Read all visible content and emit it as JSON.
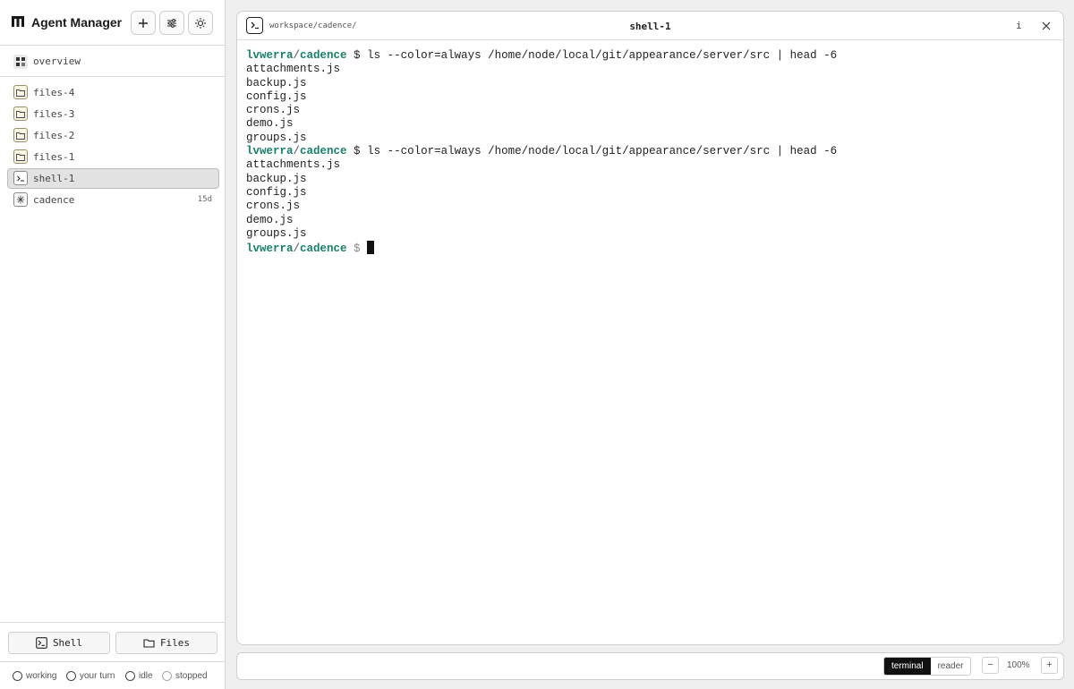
{
  "app": {
    "title": "Agent Manager"
  },
  "header_buttons": [
    {
      "name": "new-button",
      "icon": "plus-icon"
    },
    {
      "name": "settings-button",
      "icon": "sliders-icon"
    },
    {
      "name": "theme-button",
      "icon": "sun-icon"
    }
  ],
  "sidebar": {
    "overview_label": "overview",
    "items": [
      {
        "label": "files-4",
        "type": "folder",
        "meta": ""
      },
      {
        "label": "files-3",
        "type": "folder",
        "meta": ""
      },
      {
        "label": "files-2",
        "type": "folder",
        "meta": ""
      },
      {
        "label": "files-1",
        "type": "folder",
        "meta": ""
      },
      {
        "label": "shell-1",
        "type": "shell",
        "meta": "",
        "active": true
      },
      {
        "label": "cadence",
        "type": "agent",
        "meta": "15d"
      }
    ],
    "shell_button": "Shell",
    "files_button": "Files",
    "legend": [
      "working",
      "your turn",
      "idle",
      "stopped"
    ]
  },
  "panel": {
    "path": "workspace/cadence/",
    "title": "shell-1",
    "info_label": "i"
  },
  "terminal": {
    "user": "lvwerra",
    "dir": "cadence",
    "prompt_symbol": "$",
    "command": "ls --color=always /home/node/local/git/appearance/server/src | head -6",
    "outputs": [
      "attachments.js",
      "backup.js",
      "config.js",
      "crons.js",
      "demo.js",
      "groups.js"
    ],
    "repeat": 2
  },
  "bottom_bar": {
    "modes": [
      "terminal",
      "reader"
    ],
    "active_mode": "terminal",
    "zoom_minus": "−",
    "zoom_level": "100%",
    "zoom_plus": "+"
  },
  "colors": {
    "accent_user": "#1a7f6a",
    "active_mode_bg": "#111111"
  }
}
